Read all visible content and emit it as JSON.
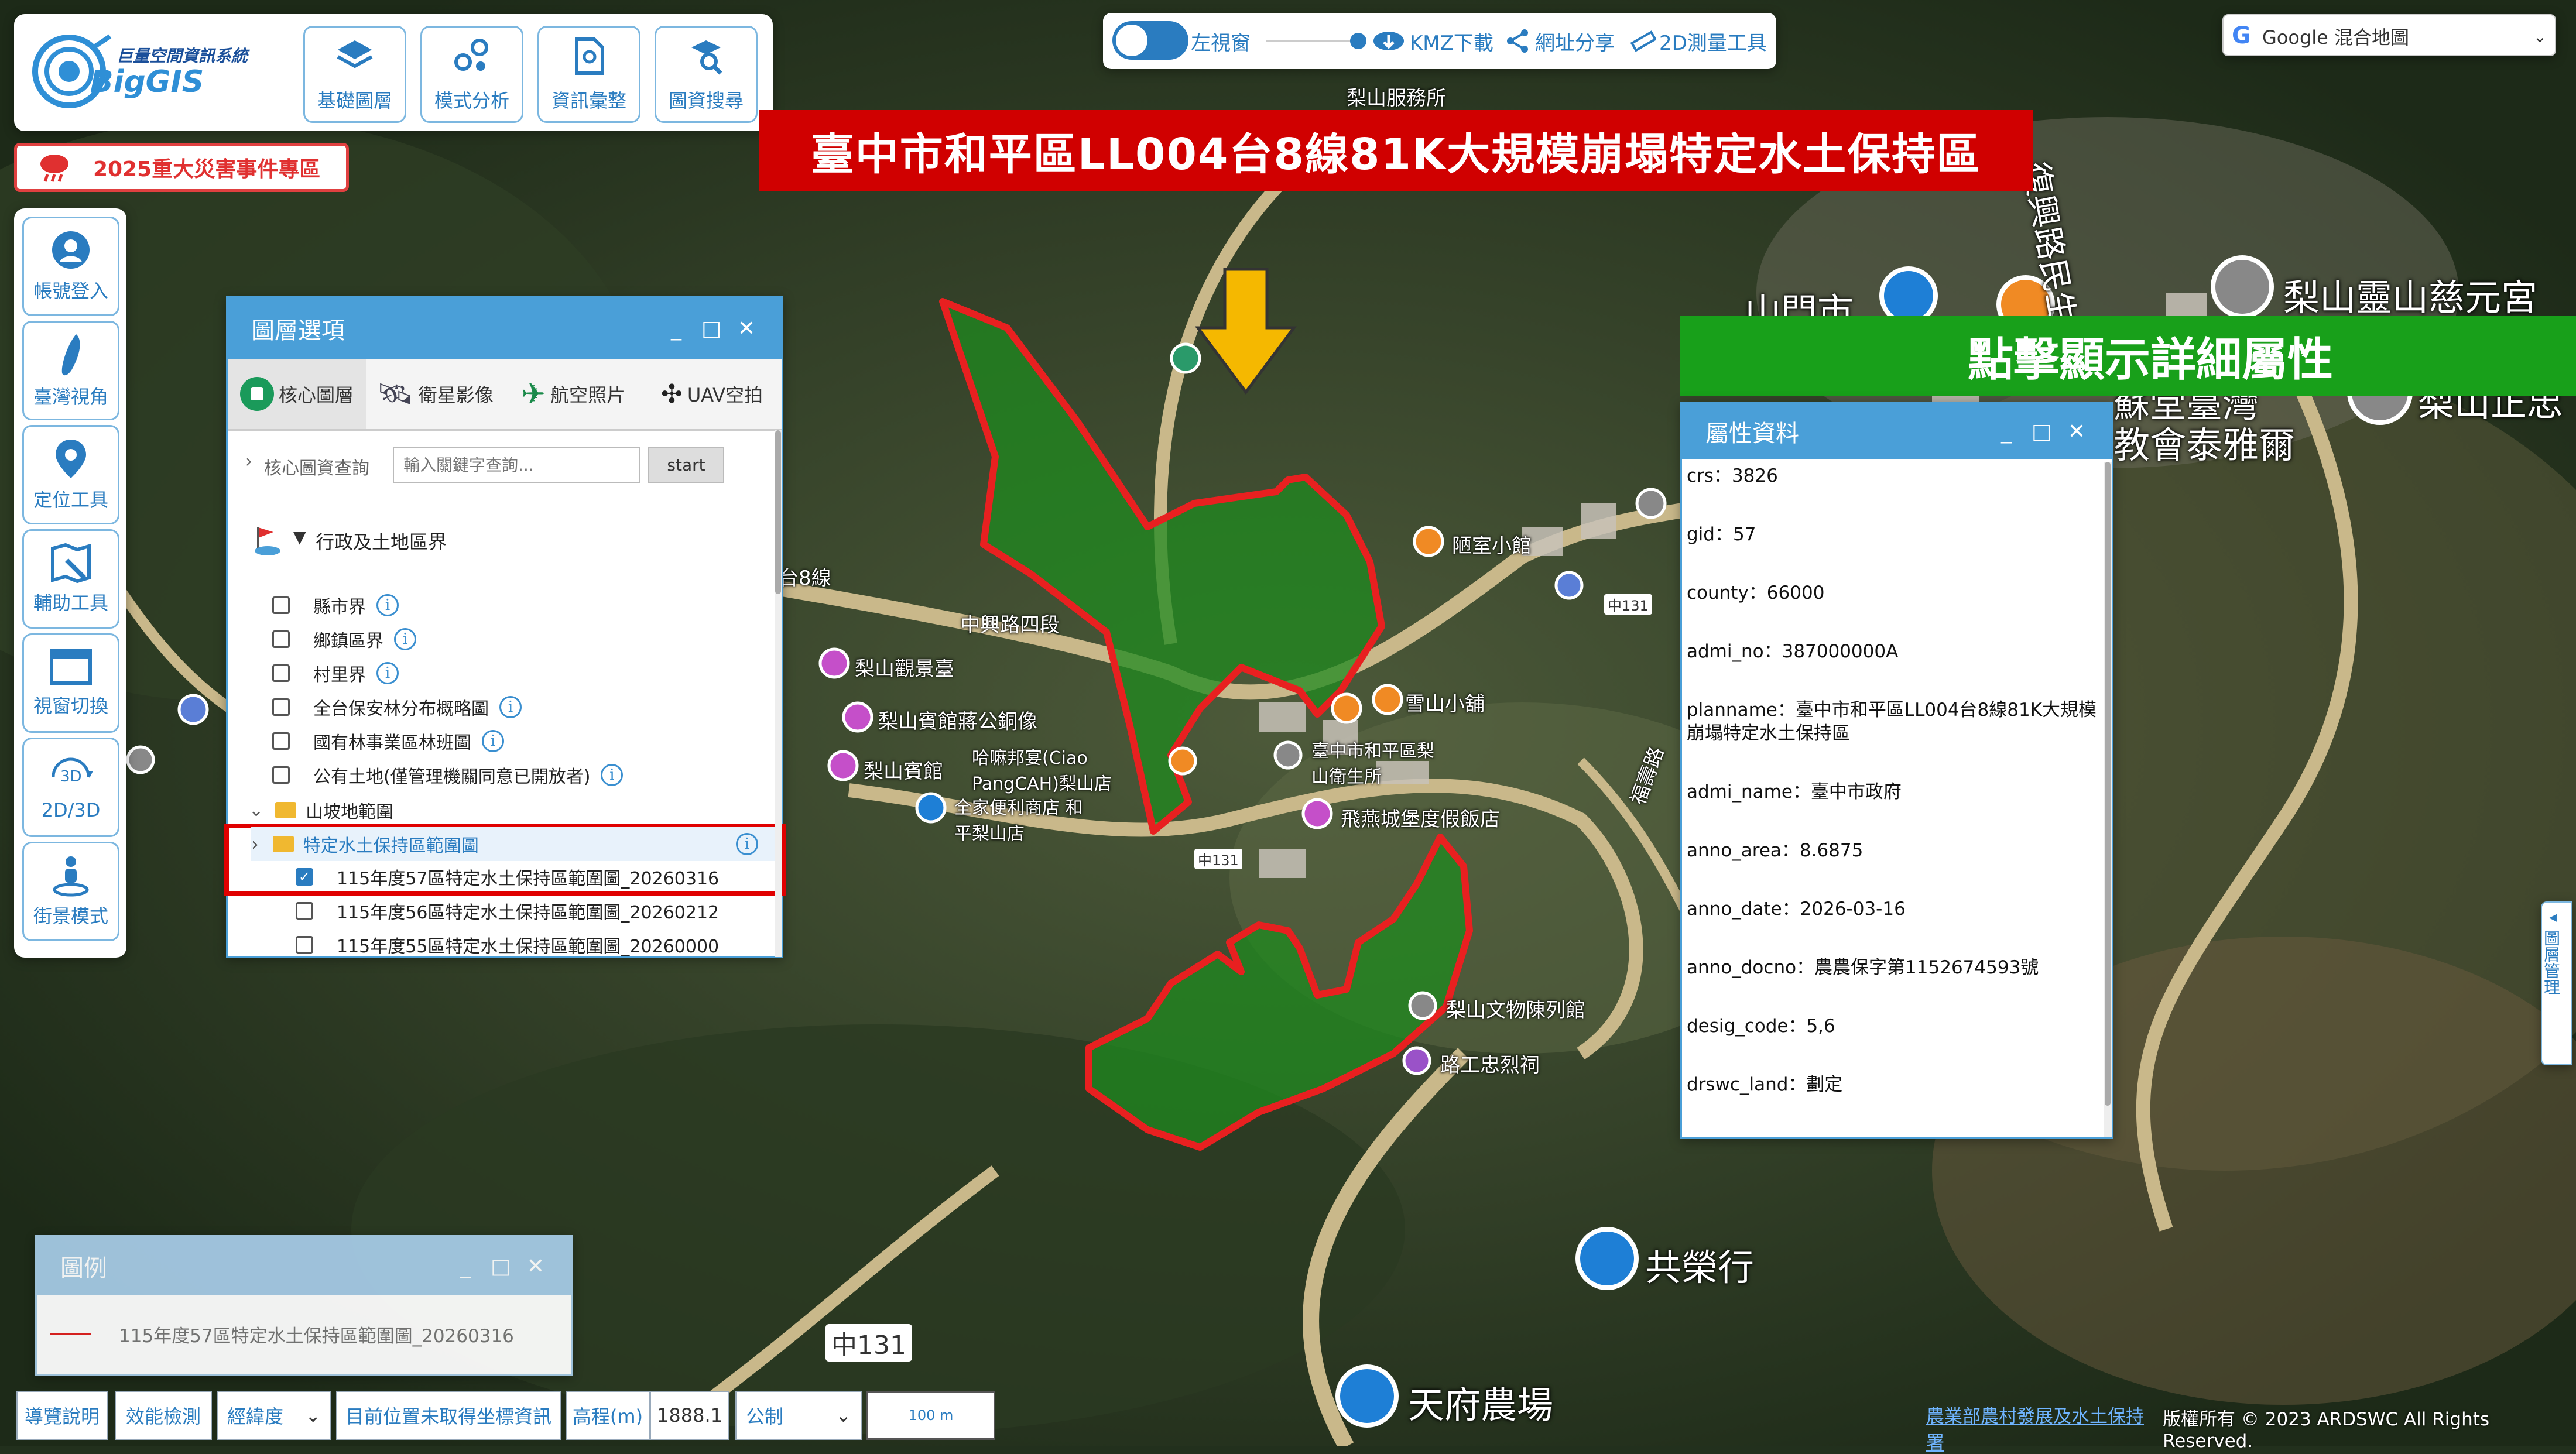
{
  "app": {
    "logo_title": "巨量空間資訊系統",
    "logo_name": "BigGIS"
  },
  "toolbar": {
    "items": [
      {
        "label": "基礎圖層",
        "icon": "layers-icon"
      },
      {
        "label": "模式分析",
        "icon": "analysis-icon"
      },
      {
        "label": "資訊彙整",
        "icon": "document-pin-icon"
      },
      {
        "label": "圖資搜尋",
        "icon": "search-map-icon"
      }
    ]
  },
  "event_banner": "2025重大災害事件專區",
  "sidebar": {
    "items": [
      {
        "label": "帳號登入",
        "icon": "user-icon"
      },
      {
        "label": "臺灣視角",
        "icon": "taiwan-icon"
      },
      {
        "label": "定位工具",
        "icon": "location-pin-icon"
      },
      {
        "label": "輔助工具",
        "icon": "ruler-map-icon"
      },
      {
        "label": "視窗切換",
        "icon": "window-icon"
      },
      {
        "label": "2D/3D",
        "icon": "3d-icon"
      },
      {
        "label": "街景模式",
        "icon": "pegman-icon"
      }
    ]
  },
  "top_tools": {
    "left_view": "左視窗",
    "kmz": "KMZ下載",
    "share": "網址分享",
    "measure": "2D測量工具"
  },
  "basemap_select": {
    "value": "Google 混合地圖"
  },
  "title_banner": "臺中市和平區LL004台8線81K大規模崩塌特定水土保持區",
  "callout": "點擊顯示詳細屬性",
  "layers_panel": {
    "title": "圖層選項",
    "tabs": [
      {
        "label": "核心圖層",
        "icon": "core-layer-icon"
      },
      {
        "label": "衛星影像",
        "icon": "satellite-icon"
      },
      {
        "label": "航空照片",
        "icon": "airplane-icon"
      },
      {
        "label": "UAV空拍",
        "icon": "drone-icon"
      }
    ],
    "query_label": "核心圖資查詢",
    "query_placeholder": "輸入關鍵字查詢...",
    "query_button": "start",
    "group_title": "行政及土地區界",
    "items": [
      {
        "label": "縣市界",
        "checked": false
      },
      {
        "label": "鄉鎮區界",
        "checked": false
      },
      {
        "label": "村里界",
        "checked": false
      },
      {
        "label": "全台保安林分布概略圖",
        "checked": false
      },
      {
        "label": "國有林事業區林班圖",
        "checked": false
      },
      {
        "label": "公有土地(僅管理機關同意已開放者)",
        "checked": false
      }
    ],
    "folder1": "山坡地範圍",
    "folder2": "特定水土保持區範圍圖",
    "sub_items": [
      {
        "label": "115年度57區特定水土保持區範圍圖_20260316",
        "checked": true
      },
      {
        "label": "115年度56區特定水土保持區範圍圖_20260212",
        "checked": false
      },
      {
        "label": "115年度55區特定水土保持區範圍圖_20260000",
        "checked": false
      }
    ]
  },
  "attr_panel": {
    "title": "屬性資料",
    "rows": [
      "crs：3826",
      "gid：57",
      "county：66000",
      "admi_no：387000000A",
      "planname：臺中市和平區LL004台8線81K大規模崩塌特定水土保持區",
      "admi_name：臺中市政府",
      "anno_area：8.6875",
      "anno_date：2026-03-16",
      "anno_docno：農農保字第1152674593號",
      "desig_code：5,6",
      "drswc_land：劃定"
    ]
  },
  "legend": {
    "title": "圖例",
    "item": "115年度57區特定水土保持區範圍圖_20260316",
    "line_color": "#e02020"
  },
  "bottom_bar": {
    "guide": "導覽說明",
    "perf": "效能檢測",
    "coord_mode": "經緯度",
    "position_text": "目前位置未取得坐標資訊",
    "elev_label": "高程(m)",
    "elev_value": "1888.1",
    "unit": "公制",
    "scale": "100 m"
  },
  "right_tab": "圖層管理",
  "copyright": {
    "org": "農業部農村發展及水土保持署",
    "rights": "版權所有 © 2023 ARDSWC All Rights Reserved."
  },
  "map_labels": {
    "road1": "中興路四段",
    "road_code": "中131",
    "place1": "梨山觀景臺",
    "place2": "梨山賓館蔣公銅像",
    "place3": "梨山賓館",
    "place4": "哈嘛邦宴(Ciao PangCAH)梨山店",
    "place5": "全家便利商店 和平梨山店",
    "place6": "臺中市和平區梨山衛生所",
    "place7": "雪山小舖",
    "place8": "陋室小館",
    "place9": "飛燕城堡度假飯店",
    "place10": "梨山文物陳列館",
    "place11": "路工忠烈祠",
    "place12": "共榮行",
    "place13": "天府農場",
    "place14": "梨山正忠",
    "place15": "梨山靈山慈元宮",
    "place16": "山門市",
    "place17": "蘇堂臺灣",
    "place18": "教會泰雅爾",
    "road2": "福壽路",
    "road3": "復興路民生巷",
    "road4": "梨山服務所",
    "road5": "台8線",
    "road6": "中興路"
  },
  "colors": {
    "accent": "#4a9fd8",
    "banner_red": "#d00000",
    "callout_green": "#18a01a",
    "zone_fill": "#1a7a1a",
    "zone_line": "#e82020"
  }
}
